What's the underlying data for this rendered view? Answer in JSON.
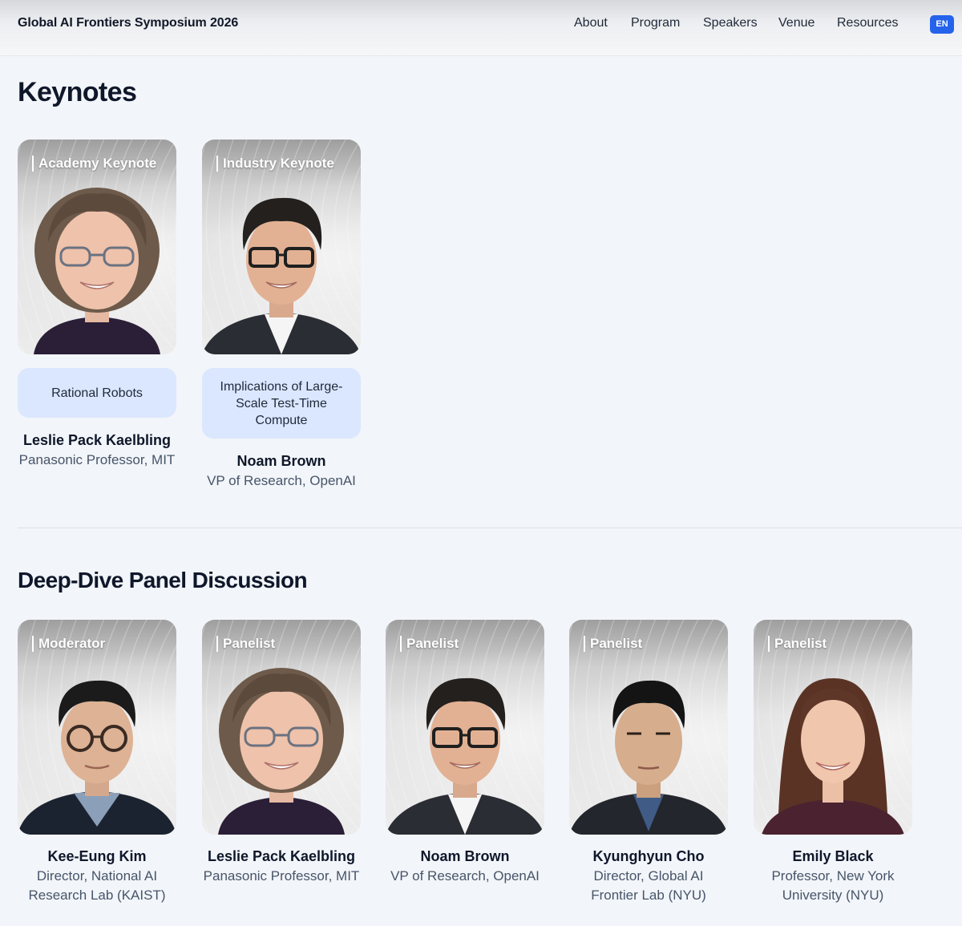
{
  "header": {
    "site_title": "Global AI Frontiers Symposium 2026",
    "nav": [
      "About",
      "Program",
      "Speakers",
      "Venue",
      "Resources"
    ],
    "language": "EN"
  },
  "keynotes": {
    "title": "Keynotes",
    "cards": [
      {
        "role": "Academy Keynote",
        "talk": "Rational Robots",
        "name": "Leslie Pack Kaelbling",
        "affiliation": "Panasonic Professor, MIT"
      },
      {
        "role": "Industry Keynote",
        "talk": "Implications of Large-Scale Test-Time Compute",
        "name": "Noam Brown",
        "affiliation": "VP of Research, OpenAI"
      }
    ]
  },
  "panel": {
    "title": "Deep-Dive Panel Discussion",
    "cards": [
      {
        "role": "Moderator",
        "name": "Kee-Eung Kim",
        "affiliation": "Director, National AI Research Lab (KAIST)"
      },
      {
        "role": "Panelist",
        "name": "Leslie Pack Kaelbling",
        "affiliation": "Panasonic Professor, MIT"
      },
      {
        "role": "Panelist",
        "name": "Noam Brown",
        "affiliation": "VP of Research, OpenAI"
      },
      {
        "role": "Panelist",
        "name": "Kyunghyun Cho",
        "affiliation": "Director, Global AI Frontier Lab (NYU)"
      },
      {
        "role": "Panelist",
        "name": "Emily Black",
        "affiliation": "Professor, New York University (NYU)"
      }
    ]
  },
  "colors": {
    "accent": "#2563eb",
    "talk_bg": "#dbe7fe",
    "page_bg": "#f2f5f9"
  }
}
